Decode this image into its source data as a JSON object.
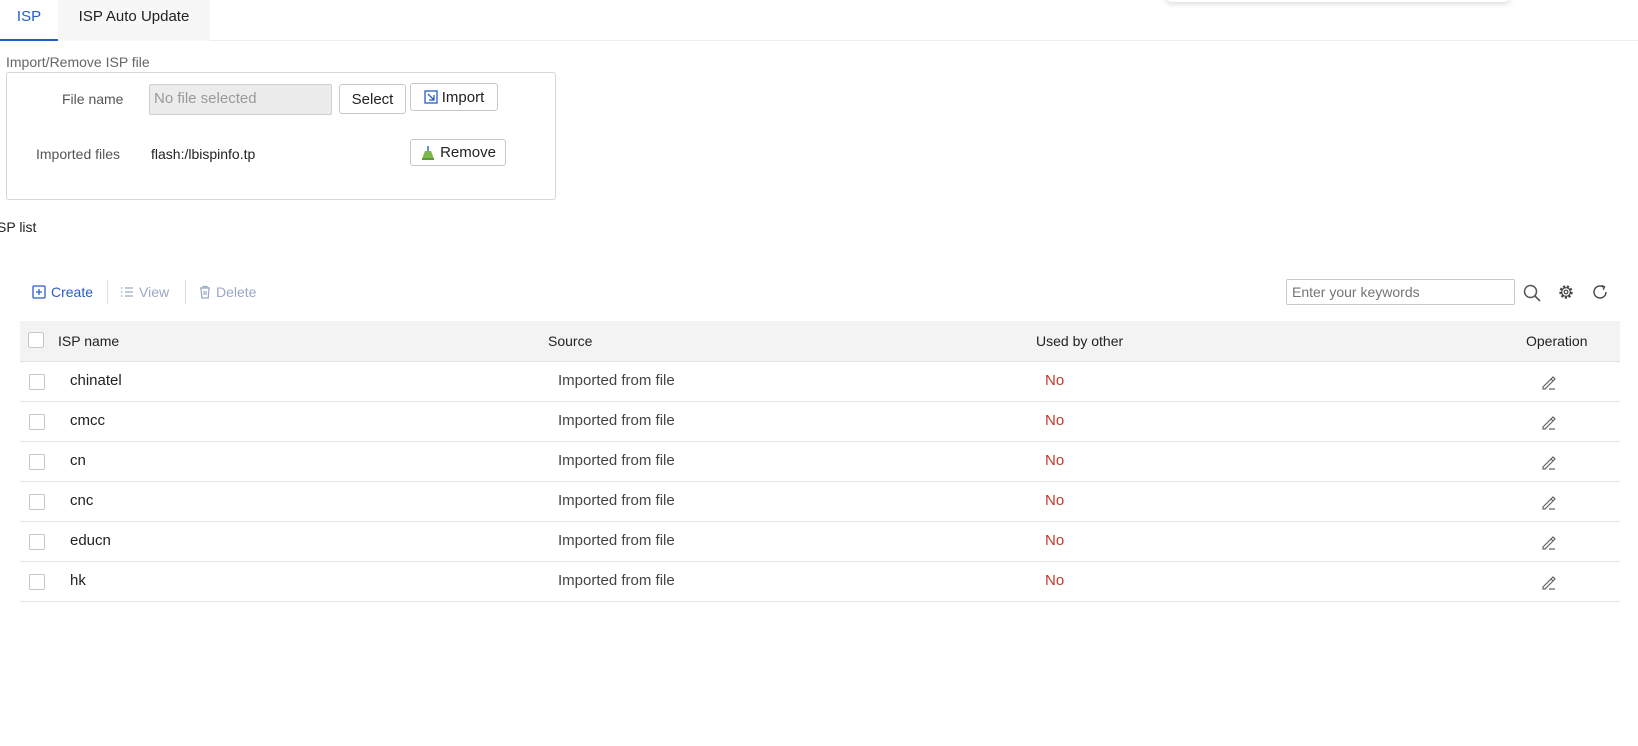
{
  "tabs": [
    {
      "label": "ISP",
      "active": true
    },
    {
      "label": "ISP Auto Update",
      "active": false
    }
  ],
  "import_group": {
    "title": "Import/Remove ISP file",
    "file_name_label": "File name",
    "file_placeholder": "No file selected",
    "select_label": "Select",
    "import_label": "Import",
    "imported_label": "Imported files",
    "imported_value": "flash:/lbispinfo.tp",
    "remove_label": "Remove"
  },
  "list_title": "SP list",
  "toolbar": {
    "create": "Create",
    "view": "View",
    "delete": "Delete",
    "search_placeholder": "Enter your keywords"
  },
  "table": {
    "columns": [
      "ISP name",
      "Source",
      "Used by other",
      "Operation"
    ],
    "rows": [
      {
        "name": "chinatel",
        "source": "Imported from file",
        "used": "No"
      },
      {
        "name": "cmcc",
        "source": "Imported from file",
        "used": "No"
      },
      {
        "name": "cn",
        "source": "Imported from file",
        "used": "No"
      },
      {
        "name": "cnc",
        "source": "Imported from file",
        "used": "No"
      },
      {
        "name": "educn",
        "source": "Imported from file",
        "used": "No"
      },
      {
        "name": "hk",
        "source": "Imported from file",
        "used": "No"
      }
    ]
  },
  "colors": {
    "accent": "#1f5fc8",
    "disabled": "#9aa7c6",
    "negative": "#c0392b"
  }
}
